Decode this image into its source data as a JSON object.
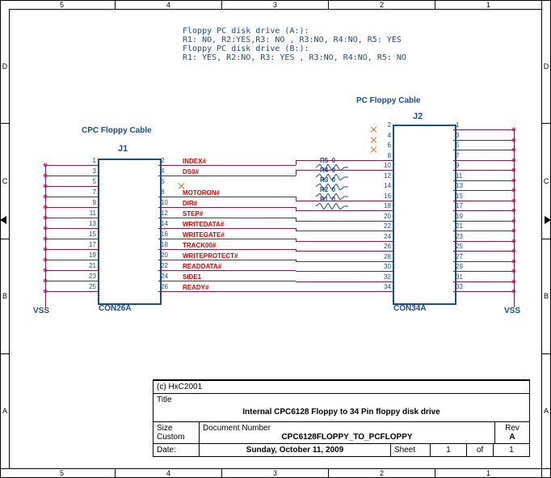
{
  "ruler_top": [
    "5",
    "4",
    "3",
    "2",
    "1"
  ],
  "ruler_side": [
    "D",
    "C",
    "B",
    "A"
  ],
  "config": "Floppy PC disk drive (A:):\nR1: NO, R2:YES,R3: NO , R3:NO, R4:NO, R5: YES\nFloppy PC disk drive (B:):\nR1: YES, R2:NO, R3: YES , R3:NO, R4:NO, R5: NO",
  "j1": {
    "title": "CPC Floppy Cable",
    "ref": "J1",
    "type": "CON26A"
  },
  "j2": {
    "title": "PC Floppy Cable",
    "ref": "J2",
    "type": "CON34A"
  },
  "vss_left": "VSS",
  "vss_right": "VSS",
  "j1_left": [
    "1",
    "3",
    "5",
    "7",
    "9",
    "11",
    "13",
    "15",
    "17",
    "19",
    "21",
    "23",
    "25"
  ],
  "j1_right": [
    "2",
    "4",
    "6",
    "8",
    "10",
    "12",
    "14",
    "16",
    "18",
    "20",
    "22",
    "24",
    "26"
  ],
  "j2_left": [
    "2",
    "4",
    "6",
    "8",
    "10",
    "12",
    "14",
    "16",
    "18",
    "20",
    "22",
    "24",
    "26",
    "28",
    "30",
    "32",
    "34"
  ],
  "j2_right": [
    "1",
    "3",
    "5",
    "7",
    "9",
    "11",
    "13",
    "15",
    "17",
    "19",
    "21",
    "23",
    "25",
    "27",
    "29",
    "31",
    "33"
  ],
  "signals": [
    "INDEX#",
    "DS0#",
    "",
    "MOTORON#",
    "DIR#",
    "STEP#",
    "WRITEDATA#",
    "WRITEGATE#",
    "TRACK00#",
    "WRITEPROTECT#",
    "READDATA#",
    "SIDE1",
    "READY#"
  ],
  "resistors": [
    {
      "ref": "R5",
      "val": "0"
    },
    {
      "ref": "R4",
      "val": "0"
    },
    {
      "ref": "R3",
      "val": "0"
    },
    {
      "ref": "R2",
      "val": "0"
    },
    {
      "ref": "R1",
      "val": "0"
    }
  ],
  "titleblock": {
    "copyright": "(c) HxC2001",
    "title_lbl": "Title",
    "title": "Internal CPC6128 Floppy to 34 Pin floppy disk drive",
    "size_lbl": "Size",
    "size": "Custom",
    "docnum_lbl": "Document Number",
    "docnum": "CPC6128FLOPPY_TO_PCFLOPPY",
    "rev_lbl": "Rev",
    "rev": "A",
    "date_lbl": "Date:",
    "date": "Sunday, October 11, 2009",
    "sheet_lbl": "Sheet",
    "sheet_of": "of",
    "sheet_n": "1",
    "sheet_m": "1"
  },
  "chart_data": {
    "type": "table",
    "title": "Internal CPC6128 Floppy to 34 Pin floppy disk drive",
    "connectors": [
      {
        "ref": "J1",
        "type": "CON26A",
        "label": "CPC Floppy Cable",
        "pins": 26
      },
      {
        "ref": "J2",
        "type": "CON34A",
        "label": "PC Floppy Cable",
        "pins": 34
      }
    ],
    "nets": [
      {
        "signal": "INDEX#",
        "j1_pin": 2,
        "j2_pin": 8
      },
      {
        "signal": "DS0#",
        "j1_pin": 4,
        "j2_pin": 10,
        "via": "R5"
      },
      {
        "signal": "MOTORON#",
        "j1_pin": 8,
        "j2_pin": 16
      },
      {
        "signal": "DIR#",
        "j1_pin": 10,
        "j2_pin": 18
      },
      {
        "signal": "STEP#",
        "j1_pin": 12,
        "j2_pin": 20
      },
      {
        "signal": "WRITEDATA#",
        "j1_pin": 14,
        "j2_pin": 22
      },
      {
        "signal": "WRITEGATE#",
        "j1_pin": 16,
        "j2_pin": 24
      },
      {
        "signal": "TRACK00#",
        "j1_pin": 18,
        "j2_pin": 26
      },
      {
        "signal": "WRITEPROTECT#",
        "j1_pin": 20,
        "j2_pin": 28
      },
      {
        "signal": "READDATA#",
        "j1_pin": 22,
        "j2_pin": 30
      },
      {
        "signal": "SIDE1",
        "j1_pin": 24,
        "j2_pin": 32
      },
      {
        "signal": "READY#",
        "j1_pin": 26,
        "j2_pin": 34
      }
    ],
    "resistors": [
      {
        "ref": "R1",
        "value": 0
      },
      {
        "ref": "R2",
        "value": 0
      },
      {
        "ref": "R3",
        "value": 0
      },
      {
        "ref": "R4",
        "value": 0
      },
      {
        "ref": "R5",
        "value": 0
      }
    ],
    "ground": {
      "j1_odd_pins": "VSS",
      "j2_odd_pins": "VSS"
    }
  }
}
